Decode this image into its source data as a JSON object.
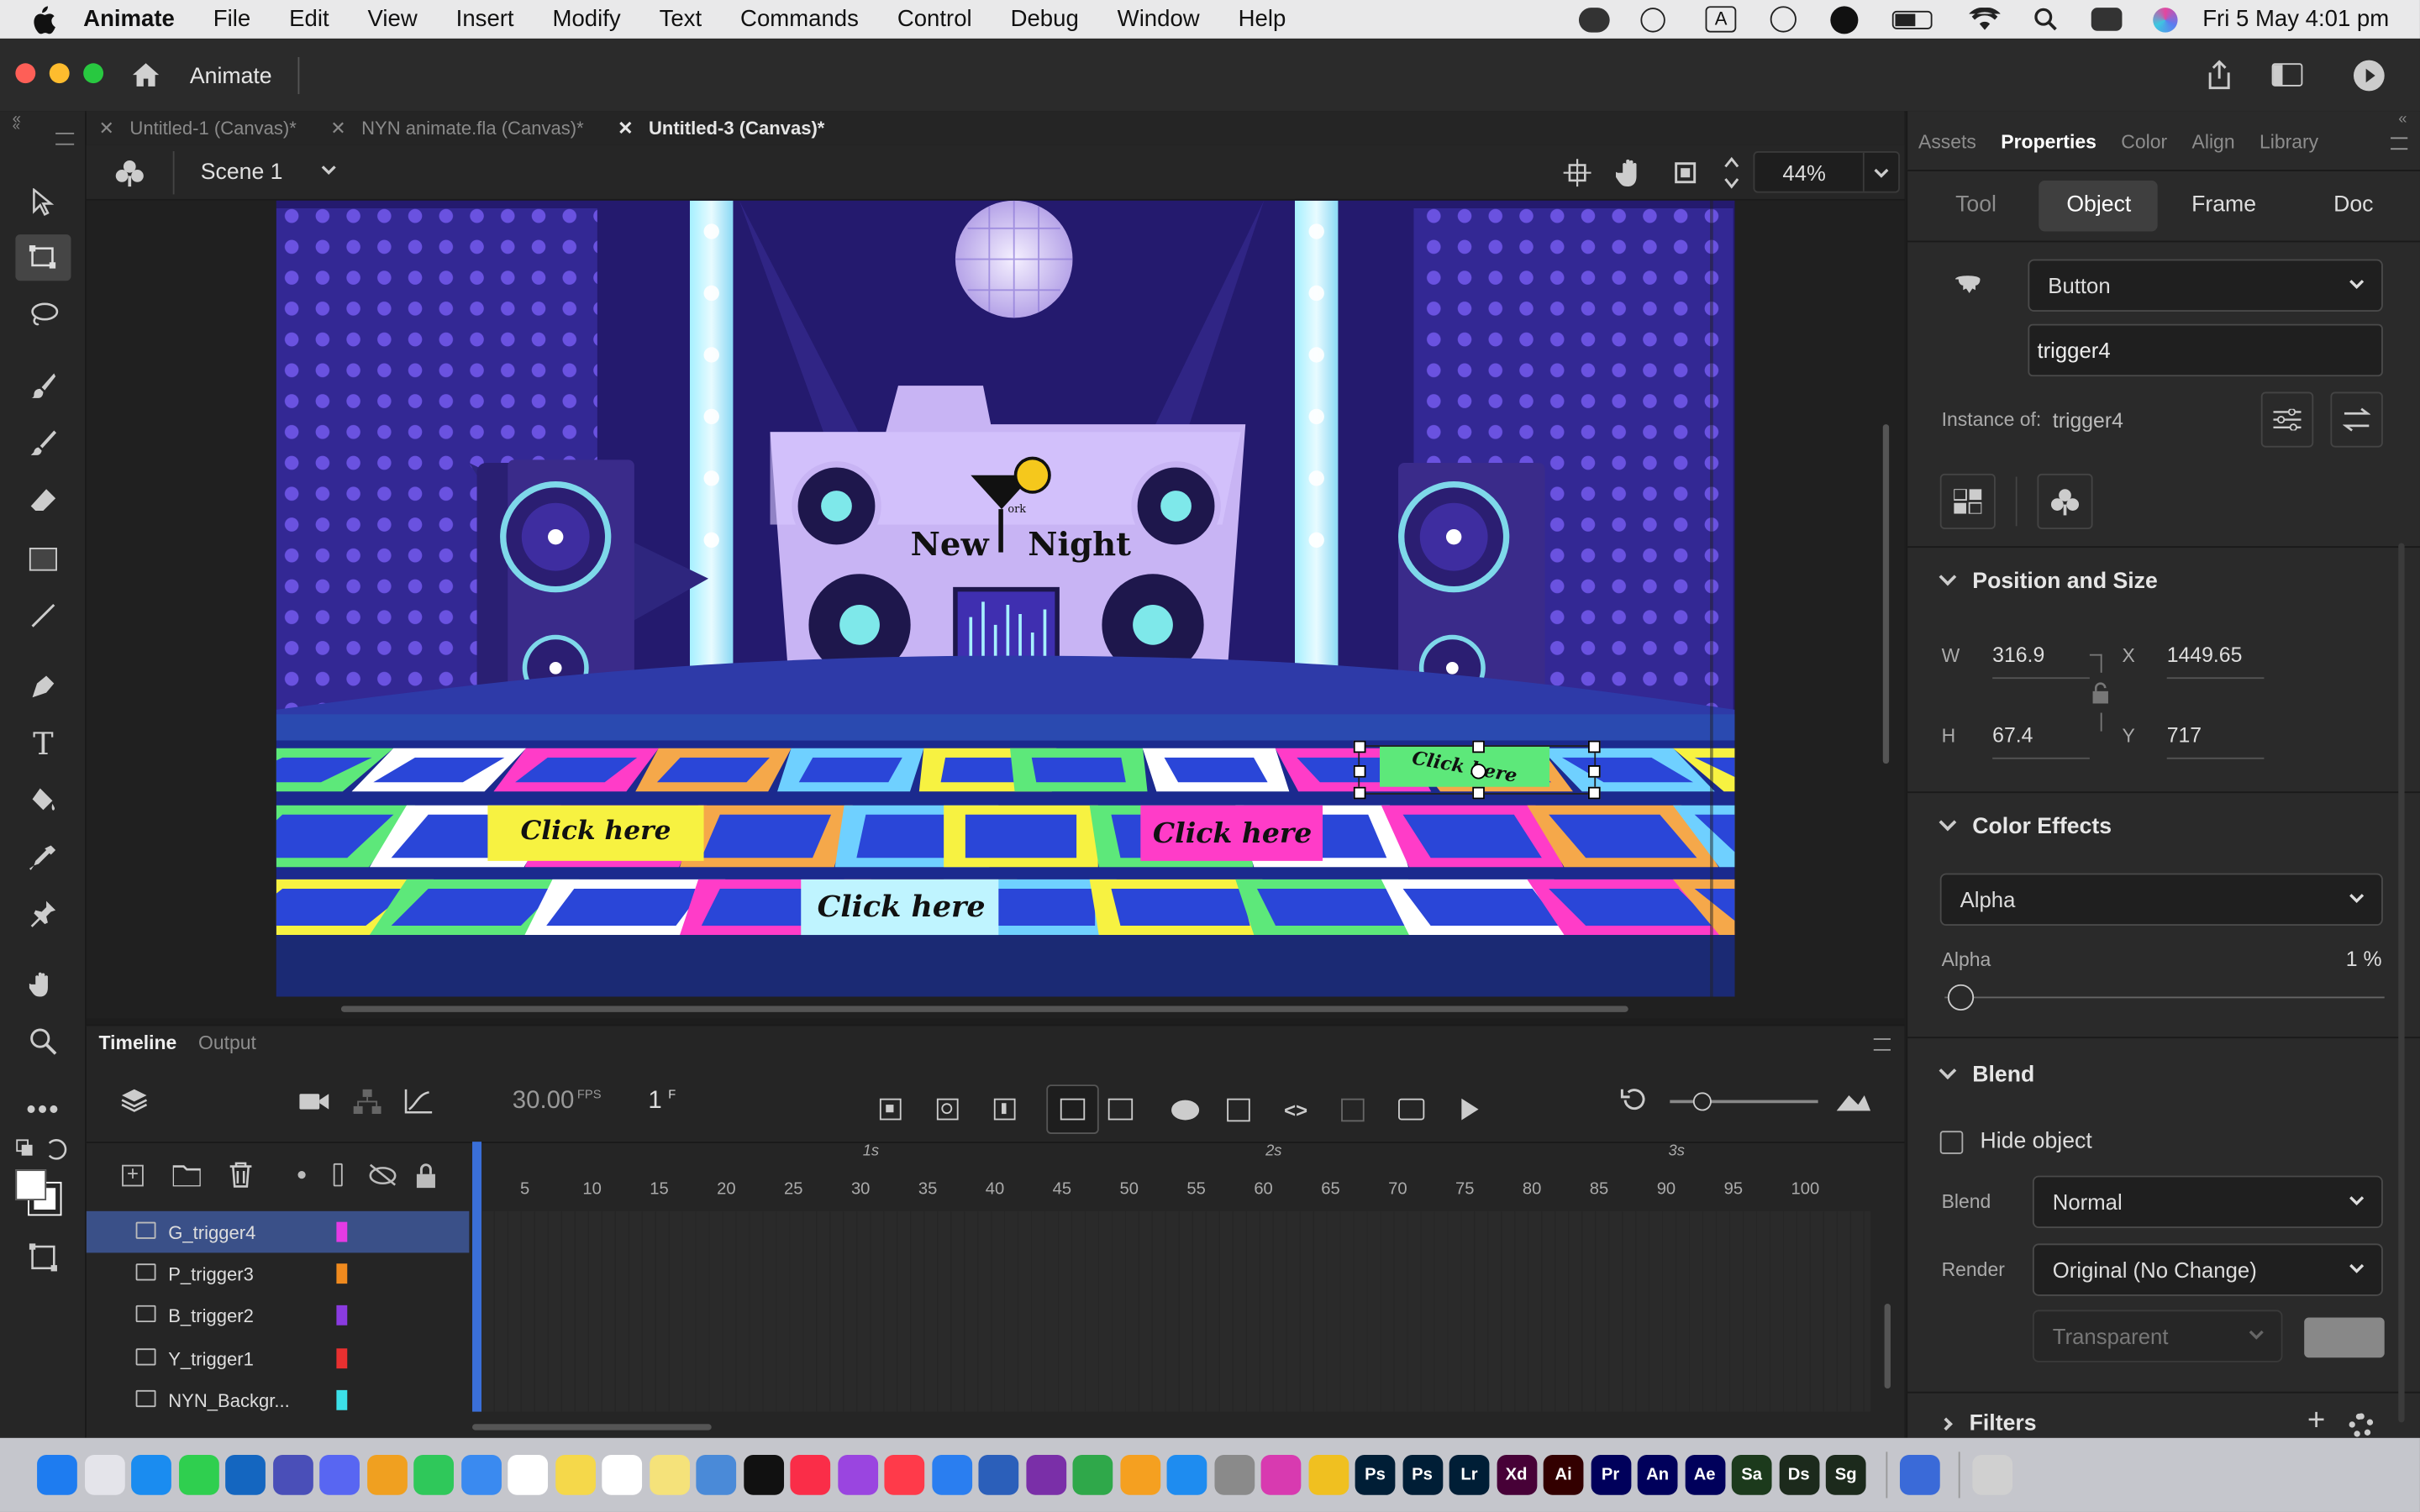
{
  "menubar": {
    "app": "Animate",
    "items": [
      "File",
      "Edit",
      "View",
      "Insert",
      "Modify",
      "Text",
      "Commands",
      "Control",
      "Debug",
      "Window",
      "Help"
    ],
    "datetime": "Fri 5 May  4:01 pm"
  },
  "window": {
    "title": "Animate"
  },
  "doc_tabs": [
    "Untitled-1 (Canvas)*",
    "NYN animate.fla (Canvas)*",
    "Untitled-3 (Canvas)*"
  ],
  "scene": {
    "name": "Scene 1",
    "zoom": "44%"
  },
  "stage": {
    "logo_line1": "New",
    "logo_line2": "Night",
    "logo_small": "ork",
    "buttons": [
      "Click here",
      "Click here",
      "Click here",
      "Click here"
    ]
  },
  "timeline": {
    "tabs": [
      "Timeline",
      "Output"
    ],
    "fps": "30.00",
    "fps_unit": "FPS",
    "frame": "1",
    "frame_unit": "F",
    "seconds": [
      "1s",
      "2s",
      "3s"
    ],
    "ruler": [
      "5",
      "10",
      "15",
      "20",
      "25",
      "30",
      "35",
      "40",
      "45",
      "50",
      "55",
      "60",
      "65",
      "70",
      "75",
      "80",
      "85",
      "90",
      "95",
      "100"
    ],
    "layers": [
      {
        "name": "G_trigger4",
        "color": "#e43be4"
      },
      {
        "name": "P_trigger3",
        "color": "#f08a1e"
      },
      {
        "name": "B_trigger2",
        "color": "#8a3be0"
      },
      {
        "name": "Y_trigger1",
        "color": "#e83030"
      },
      {
        "name": "NYN_Backgr...",
        "color": "#3ce0e8"
      }
    ]
  },
  "panel": {
    "tabs": [
      "Assets",
      "Properties",
      "Color",
      "Align",
      "Library"
    ],
    "subtabs": [
      "Tool",
      "Object",
      "Frame",
      "Doc"
    ],
    "symbol_type": "Button",
    "instance_name": "trigger4",
    "instance_of_label": "Instance of:",
    "instance_of": "trigger4",
    "pos": {
      "title": "Position and Size",
      "w_label": "W",
      "w": "316.9",
      "x_label": "X",
      "x": "1449.65",
      "h_label": "H",
      "h": "67.4",
      "y_label": "Y",
      "y": "717"
    },
    "color_effects": {
      "title": "Color Effects",
      "mode": "Alpha",
      "alpha_label": "Alpha",
      "alpha": "1 %",
      "alpha_fraction": 0.01
    },
    "blend": {
      "title": "Blend",
      "hide_label": "Hide object",
      "blend_label": "Blend",
      "blend": "Normal",
      "render_label": "Render",
      "render": "Original (No Change)",
      "bg": "Transparent"
    },
    "filters": {
      "title": "Filters"
    }
  },
  "colors": {
    "accent": "#3a5088",
    "menubar": "#e9e9ea",
    "stage_bg": "#1b1f6b"
  },
  "dock_apps": [
    "Finder",
    "Launchpad",
    "Safari",
    "Messages",
    "Outlook",
    "Teams",
    "Discord",
    "Photos",
    "FaceTime",
    "Finder2",
    "Calendar",
    "Notes",
    "Reminders",
    "Stickies",
    "Preview",
    "TV",
    "Music",
    "Podcasts",
    "News",
    "Keynote",
    "Word",
    "OneNote",
    "Numbers",
    "Pages",
    "App Store",
    "Settings",
    "Instagram",
    "Chrome",
    "Ps",
    "Ps",
    "Lr",
    "Xd",
    "Ai",
    "Pr",
    "An",
    "Ae",
    "Sa",
    "Ds",
    "Sg",
    "Downloads",
    "Trash"
  ]
}
